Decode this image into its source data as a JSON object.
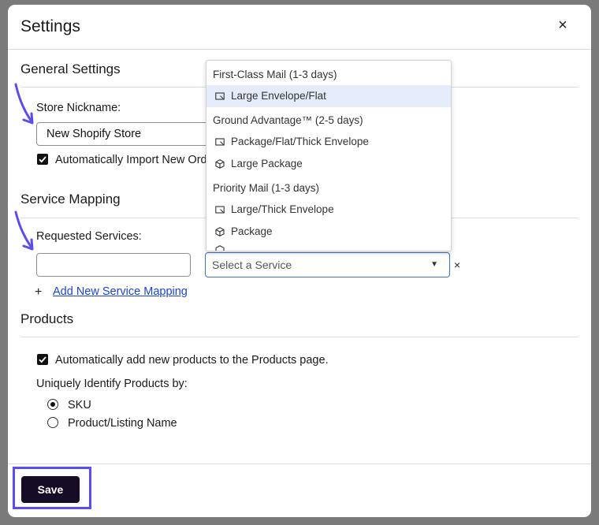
{
  "modal": {
    "title": "Settings",
    "close_label": "×"
  },
  "general": {
    "title": "General Settings",
    "nickname_label": "Store Nickname:",
    "nickname_value": "New Shopify Store",
    "auto_import_label": "Automatically Import New Ord",
    "auto_import_checked": true
  },
  "service_mapping": {
    "title": "Service Mapping",
    "requested_label": "Requested Services:",
    "requested_value": "",
    "select_placeholder": "Select a Service",
    "clear_label": "×",
    "add_plus": "+",
    "add_link": "Add New Service Mapping"
  },
  "dropdown": {
    "groups": [
      {
        "label": "First-Class Mail (1-3 days)"
      },
      {
        "label": "Ground Advantage™ (2-5 days)"
      },
      {
        "label": "Priority Mail (1-3 days)"
      }
    ],
    "items": [
      {
        "label": "Large Envelope/Flat",
        "icon": "envelope-icon",
        "highlighted": true
      },
      {
        "label": "Package/Flat/Thick Envelope",
        "icon": "envelope-icon",
        "highlighted": false
      },
      {
        "label": "Large Package",
        "icon": "box-icon",
        "highlighted": false
      },
      {
        "label": "Large/Thick Envelope",
        "icon": "envelope-icon",
        "highlighted": false
      },
      {
        "label": "Package",
        "icon": "box-icon",
        "highlighted": false
      }
    ]
  },
  "products": {
    "title": "Products",
    "auto_add_label": "Automatically add new products to the Products page.",
    "auto_add_checked": true,
    "identify_label": "Uniquely Identify Products by:",
    "options": [
      {
        "label": "SKU",
        "selected": true
      },
      {
        "label": "Product/Listing Name",
        "selected": false
      }
    ]
  },
  "footer": {
    "save_label": "Save"
  },
  "colors": {
    "accent": "#5b4ef0",
    "link": "#1a44d6",
    "save_bg": "#160c26",
    "highlight": "#e4ebfa"
  }
}
